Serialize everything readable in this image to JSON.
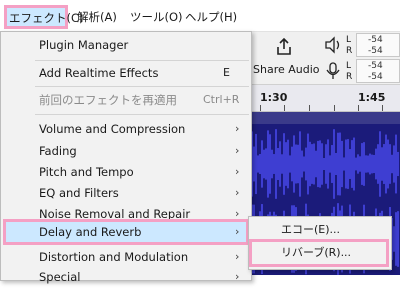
{
  "menubar": {
    "items": [
      {
        "label": "エフェクト(C)"
      },
      {
        "label": "解析(A)"
      },
      {
        "label": "ツール(O)"
      },
      {
        "label": "ヘルプ(H)"
      }
    ]
  },
  "toolbar": {
    "share_label": "Share Audio",
    "meters": [
      {
        "channel_l": "L",
        "channel_r": "R",
        "value_l": "-54",
        "value_r": "-54"
      },
      {
        "channel_l": "L",
        "channel_r": "R",
        "value_l": "-54",
        "value_r": "-54"
      }
    ]
  },
  "timeline": {
    "labels": [
      "1:30",
      "1:45"
    ]
  },
  "menu": {
    "items": [
      {
        "label": "Plugin Manager"
      },
      {
        "label": "Add Realtime Effects",
        "shortcut": "E"
      },
      {
        "label": "前回のエフェクトを再適用",
        "shortcut": "Ctrl+R",
        "disabled": true
      },
      {
        "label": "Volume and Compression",
        "arrow": "›"
      },
      {
        "label": "Fading",
        "arrow": "›"
      },
      {
        "label": "Pitch and Tempo",
        "arrow": "›"
      },
      {
        "label": "EQ and Filters",
        "arrow": "›"
      },
      {
        "label": "Noise Removal and Repair",
        "arrow": "›"
      },
      {
        "label": "Delay and Reverb",
        "arrow": "›",
        "highlighted": true
      },
      {
        "label": "Distortion and Modulation",
        "arrow": "›"
      },
      {
        "label": "Special",
        "arrow": "›"
      }
    ]
  },
  "submenu": {
    "items": [
      {
        "label": "エコー(E)..."
      },
      {
        "label": "リバーブ(R)...",
        "highlighted": true
      }
    ]
  },
  "colors": {
    "highlight_fill": "#cce8ff",
    "highlight_border": "#f4a0c4",
    "waveform": "#4a4af0",
    "track_bg": "#1b1b7a"
  }
}
